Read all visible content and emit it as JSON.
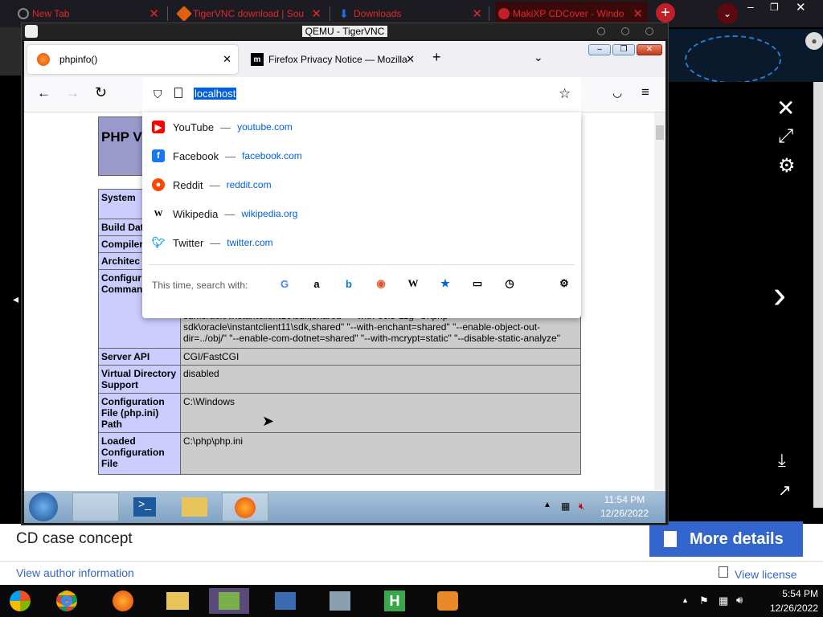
{
  "host_tabs": [
    {
      "label": "New Tab"
    },
    {
      "label": "TigerVNC download | Sou"
    },
    {
      "label": "Downloads"
    },
    {
      "label": "MakiXP CDCover - Windo"
    }
  ],
  "vnc": {
    "title": "QEMU - TigerVNC"
  },
  "firefox": {
    "tabs": [
      {
        "label": "phpinfo()"
      },
      {
        "label": "Firefox Privacy Notice — Mozilla"
      }
    ],
    "url": "localhost",
    "suggestions": [
      {
        "name": "YouTube",
        "url": "youtube.com",
        "color": "#ff0000"
      },
      {
        "name": "Facebook",
        "url": "facebook.com",
        "color": "#1877f2"
      },
      {
        "name": "Reddit",
        "url": "reddit.com",
        "color": "#ff4500"
      },
      {
        "name": "Wikipedia",
        "url": "wikipedia.org",
        "color": "#000000"
      },
      {
        "name": "Twitter",
        "url": "twitter.com",
        "color": "#1da1f2"
      }
    ],
    "search_with_label": "This time, search with:"
  },
  "php": {
    "header_title": "PHP V",
    "labels_visible": [
      "System",
      "Build Dat",
      "Compiler",
      "Architec",
      "Configur Comman"
    ],
    "config_command_text": "pi3web\" \"--with-pdo-oci=C:\\php-sdk\\oracle\\instantclient10\\sdk,shared\" \"--with-oci8=C:\\php-sdk\\oracle\\instantclient10\\sdk,shared\" \"--with-oci8-11g=C:\\php-sdk\\oracle\\instantclient11\\sdk,shared\" \"--with-enchant=shared\" \"--enable-object-out-dir=../obj/\" \"--enable-com-dotnet=shared\" \"--with-mcrypt=static\" \"--disable-static-analyze\"",
    "rows": [
      {
        "label": "Server API",
        "value": "CGI/FastCGI"
      },
      {
        "label": "Virtual Directory Support",
        "value": "disabled"
      },
      {
        "label": "Configuration File (php.ini) Path",
        "value": "C:\\Windows"
      },
      {
        "label": "Loaded Configuration File",
        "value": "C:\\php\\php.ini"
      }
    ]
  },
  "guest_taskbar": {
    "time": "11:54 PM",
    "date": "12/26/2022"
  },
  "host_page": {
    "caption": "CD case concept",
    "more_details": "More details",
    "author_link": "View author information",
    "license_link": "View license"
  },
  "host_taskbar": {
    "time": "5:54 PM",
    "date": "12/26/2022"
  }
}
